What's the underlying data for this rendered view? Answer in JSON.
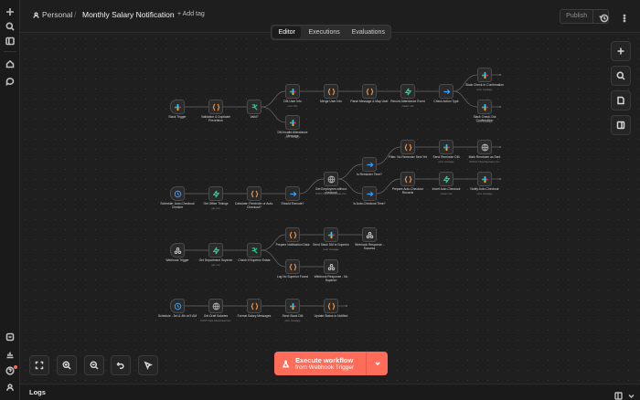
{
  "header": {
    "project": "Personal",
    "workflow_title": "Monthly Salary Notification",
    "add_tag": "+ Add tag",
    "publish": "Publish"
  },
  "tabs": [
    {
      "label": "Editor",
      "active": true
    },
    {
      "label": "Executions",
      "active": false
    },
    {
      "label": "Evaluations",
      "active": false
    }
  ],
  "nodes": {
    "slack_trigger": "Slack Trigger",
    "validation": "Validation & Duplicate Prevention",
    "valid": "Valid?",
    "dm_user_info": "DM User Info",
    "dm_user_info_sub": "user: info",
    "dm_invalid": "DM Invalid Attendance Message",
    "dm_invalid_sub": "post: message",
    "merge_user": "Merge User Info",
    "parse_msg": "Parse Message & Map User",
    "record_att": "Record Attendance Event",
    "record_att_sub": "create: row",
    "check_action": "Check Action Type",
    "slack_checkin": "Slack Check-In Confirmation",
    "slack_checkin_sub": "post: message",
    "slack_checkout": "Slack Check-Out Confirmation",
    "slack_checkout_sub": "post: message",
    "schedule_auto": "Schedule: Auto-Checkout Checker",
    "get_office": "Get Office Timings",
    "get_office_sub": "get: row",
    "calc_reminder": "Calculate: Reminder or Auto-Checkout?",
    "should_execute": "Should Execute?",
    "get_employees": "Get Employees without checkout",
    "get_employees_sub": "POST: https://www.base.com",
    "is_reminder": "Is Reminder Time?",
    "is_auto": "Is Auto-Checkout Time?",
    "filter_reminder": "Filter: No Reminder Sent Yet",
    "send_reminder": "Send Reminder DM",
    "send_reminder_sub": "post: message",
    "mark_reminder": "Mark Reminder as Sent",
    "mark_reminder_sub": "PATCH: https://api.base.com",
    "prepare_auto": "Prepare Auto-Checkout Records",
    "insert_auto": "Insert Auto-Checkout",
    "insert_auto_sub": "create: row",
    "notify_auto": "Notify Auto-Checkout",
    "notify_auto_sub": "post: message",
    "webhook": "Webhook Trigger",
    "get_dept": "Get Department Superior",
    "get_dept_sub": "get: row",
    "check_superior": "Check If Superior Exists",
    "prepare_notif": "Prepare Notification Data",
    "send_dm_superior": "Send Slack DM to Superior",
    "send_dm_superior_sub": "post: message",
    "webhook_success": "Webhook Response - Success",
    "log_no_superior": "Log No Superior Found",
    "webhook_no_sup": "Webhook Response - No Superior",
    "schedule_salary": "Schedule - 3rd & 4th at 9 AM",
    "get_drafts": "Get Draft Salaries",
    "get_drafts_sub": "POST: https://www.base.com",
    "format_salary": "Format Salary Messages",
    "send_slack_dm": "Send Slack DM",
    "send_slack_dm_sub": "post: message",
    "update_status": "Update Status to Notified"
  },
  "execute": {
    "title": "Execute workflow",
    "subtitle": "from Webhook Trigger"
  },
  "logs": {
    "label": "Logs"
  },
  "colors": {
    "accent": "#ff6d5a",
    "slack": "#e01e5a",
    "code": "#ff9b4a",
    "if_node": "#34c58b",
    "switch": "#3aa0ff"
  }
}
